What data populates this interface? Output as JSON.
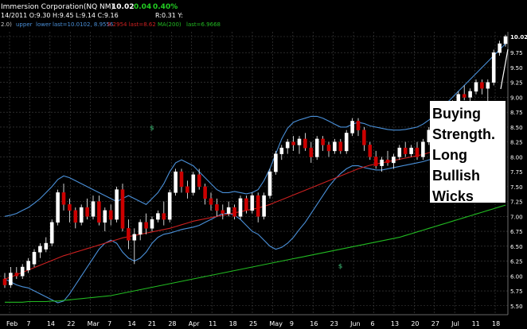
{
  "header": {
    "line1": {
      "symbol": "Immersion Corporation(NQ NM)",
      "last": "10.02",
      "change": "0.04",
      "change_pct": "0.40%",
      "date_ohlc": "14/2011 O:9.30 H:9.45 L:9.14 C:9.16",
      "right_stats": "R:0.31   Y:"
    },
    "line2": {
      "prefix": "2.0)",
      "upper": "upper",
      "lower": "lower",
      "last_label": "last=10.0102, 8.9556",
      "red_part": "8.2954  last=8.62",
      "ma_label": "MA(200)",
      "ma_last": "last=6.9668"
    }
  },
  "colors": {
    "up_candle": "#ffffff",
    "down_candle": "#cc0000",
    "bollinger": "#4a90d9",
    "ma_red": "#cc2020",
    "ma200": "#22bb22",
    "grid": "#444444",
    "change_green": "#22cc22",
    "marker": "#2e8b57"
  },
  "chart_data": {
    "type": "candlestick",
    "title": "",
    "y_ticks": [
      "10.02",
      "9.75",
      "9.50",
      "9.25",
      "9.00",
      "8.75",
      "8.50",
      "8.25",
      "8.00",
      "7.75",
      "7.50",
      "7.25",
      "7.00",
      "6.75",
      "6.50",
      "6.25",
      "6.00",
      "5.75",
      "5.50"
    ],
    "ylim": [
      5.35,
      10.1
    ],
    "x_ticks": [
      "Feb",
      "7",
      "14",
      "22",
      "Mar",
      "7",
      "14",
      "21",
      "28",
      "Apr",
      "11",
      "18",
      "25",
      "May",
      "9",
      "16",
      "23",
      "Jun",
      "6",
      "13",
      "20",
      "27",
      "Jul",
      "11",
      "18"
    ],
    "ohlc": [
      [
        5.95,
        6.05,
        5.8,
        5.85
      ],
      [
        5.85,
        6.15,
        5.8,
        6.05
      ],
      [
        6.05,
        6.15,
        5.95,
        6.0
      ],
      [
        6.0,
        6.2,
        5.95,
        6.15
      ],
      [
        6.1,
        6.3,
        6.05,
        6.25
      ],
      [
        6.2,
        6.45,
        6.15,
        6.4
      ],
      [
        6.4,
        6.55,
        6.3,
        6.5
      ],
      [
        6.45,
        6.65,
        6.4,
        6.55
      ],
      [
        6.55,
        6.95,
        6.5,
        6.9
      ],
      [
        6.9,
        7.45,
        6.85,
        7.4
      ],
      [
        7.4,
        7.55,
        7.1,
        7.2
      ],
      [
        7.2,
        7.3,
        6.9,
        7.1
      ],
      [
        7.1,
        7.15,
        6.8,
        6.9
      ],
      [
        6.9,
        7.2,
        6.85,
        7.15
      ],
      [
        7.15,
        7.3,
        6.95,
        7.0
      ],
      [
        7.0,
        7.35,
        6.95,
        7.25
      ],
      [
        7.25,
        7.35,
        6.85,
        6.9
      ],
      [
        6.9,
        7.15,
        6.75,
        7.1
      ],
      [
        7.1,
        7.2,
        6.85,
        6.95
      ],
      [
        6.95,
        7.5,
        6.9,
        7.45
      ],
      [
        7.45,
        7.55,
        6.75,
        6.8
      ],
      [
        6.8,
        6.95,
        6.45,
        6.6
      ],
      [
        6.6,
        6.8,
        6.2,
        6.7
      ],
      [
        6.7,
        6.95,
        6.6,
        6.9
      ],
      [
        6.9,
        7.05,
        6.7,
        6.8
      ],
      [
        6.8,
        7.0,
        6.75,
        6.95
      ],
      [
        6.95,
        7.1,
        6.9,
        7.05
      ],
      [
        7.05,
        7.25,
        6.85,
        6.95
      ],
      [
        6.95,
        7.45,
        6.9,
        7.4
      ],
      [
        7.4,
        7.8,
        7.35,
        7.75
      ],
      [
        7.75,
        7.8,
        7.4,
        7.5
      ],
      [
        7.5,
        7.6,
        7.3,
        7.4
      ],
      [
        7.4,
        7.75,
        7.35,
        7.7
      ],
      [
        7.7,
        7.8,
        7.45,
        7.5
      ],
      [
        7.5,
        7.55,
        7.2,
        7.3
      ],
      [
        7.3,
        7.4,
        7.1,
        7.2
      ],
      [
        7.2,
        7.3,
        7.0,
        7.1
      ],
      [
        7.1,
        7.2,
        6.95,
        7.05
      ],
      [
        7.05,
        7.25,
        7.0,
        7.15
      ],
      [
        7.15,
        7.2,
        6.95,
        7.0
      ],
      [
        7.0,
        7.35,
        6.95,
        7.3
      ],
      [
        7.3,
        7.35,
        7.05,
        7.1
      ],
      [
        7.1,
        7.4,
        7.05,
        7.35
      ],
      [
        7.35,
        7.4,
        6.9,
        7.0
      ],
      [
        7.0,
        7.4,
        6.95,
        7.35
      ],
      [
        7.35,
        7.8,
        7.3,
        7.75
      ],
      [
        7.75,
        8.1,
        7.7,
        8.05
      ],
      [
        8.05,
        8.2,
        7.95,
        8.15
      ],
      [
        8.15,
        8.3,
        8.05,
        8.25
      ],
      [
        8.25,
        8.35,
        8.1,
        8.2
      ],
      [
        8.2,
        8.35,
        8.05,
        8.3
      ],
      [
        8.3,
        8.4,
        8.1,
        8.15
      ],
      [
        8.15,
        8.25,
        7.9,
        8.0
      ],
      [
        8.0,
        8.35,
        7.95,
        8.3
      ],
      [
        8.3,
        8.35,
        8.1,
        8.2
      ],
      [
        8.2,
        8.25,
        8.0,
        8.1
      ],
      [
        8.1,
        8.3,
        8.05,
        8.25
      ],
      [
        8.25,
        8.3,
        8.05,
        8.1
      ],
      [
        8.1,
        8.45,
        8.05,
        8.4
      ],
      [
        8.4,
        8.65,
        8.35,
        8.6
      ],
      [
        8.6,
        8.65,
        8.35,
        8.45
      ],
      [
        8.45,
        8.5,
        8.1,
        8.2
      ],
      [
        8.2,
        8.25,
        7.95,
        8.0
      ],
      [
        8.0,
        8.1,
        7.8,
        7.85
      ],
      [
        7.85,
        8.0,
        7.75,
        7.95
      ],
      [
        7.95,
        8.1,
        7.85,
        7.9
      ],
      [
        7.9,
        8.05,
        7.8,
        8.0
      ],
      [
        8.0,
        8.2,
        7.95,
        8.15
      ],
      [
        8.15,
        8.25,
        8.0,
        8.05
      ],
      [
        8.05,
        8.2,
        8.0,
        8.15
      ],
      [
        8.15,
        8.25,
        7.95,
        8.0
      ],
      [
        8.0,
        8.3,
        7.95,
        8.25
      ],
      [
        8.25,
        8.5,
        8.2,
        8.45
      ],
      [
        8.45,
        8.6,
        8.4,
        8.55
      ],
      [
        8.55,
        8.7,
        8.5,
        8.65
      ],
      [
        8.65,
        8.8,
        8.6,
        8.75
      ],
      [
        8.75,
        8.95,
        8.7,
        8.9
      ],
      [
        8.9,
        9.1,
        8.85,
        9.05
      ],
      [
        9.05,
        9.2,
        8.95,
        9.0
      ],
      [
        9.0,
        9.15,
        8.9,
        9.1
      ],
      [
        9.1,
        9.3,
        9.05,
        9.25
      ],
      [
        9.25,
        9.3,
        9.05,
        9.15
      ],
      [
        9.15,
        9.3,
        8.5,
        9.25
      ],
      [
        9.25,
        9.8,
        9.2,
        9.75
      ],
      [
        9.75,
        9.95,
        9.7,
        9.9
      ],
      [
        9.9,
        10.05,
        9.85,
        10.02
      ]
    ],
    "series": [
      {
        "type": "upper-band",
        "values": [
          7.0,
          7.02,
          7.05,
          7.1,
          7.15,
          7.22,
          7.3,
          7.4,
          7.5,
          7.62,
          7.68,
          7.65,
          7.6,
          7.55,
          7.5,
          7.45,
          7.4,
          7.35,
          7.3,
          7.25,
          7.3,
          7.35,
          7.3,
          7.25,
          7.2,
          7.3,
          7.4,
          7.55,
          7.75,
          7.9,
          7.95,
          7.9,
          7.85,
          7.75,
          7.65,
          7.55,
          7.45,
          7.4,
          7.4,
          7.42,
          7.4,
          7.38,
          7.4,
          7.45,
          7.6,
          7.8,
          8.05,
          8.3,
          8.48,
          8.58,
          8.62,
          8.65,
          8.68,
          8.68,
          8.65,
          8.6,
          8.55,
          8.5,
          8.5,
          8.55,
          8.58,
          8.56,
          8.52,
          8.5,
          8.48,
          8.46,
          8.45,
          8.45,
          8.46,
          8.48,
          8.5,
          8.55,
          8.62,
          8.7,
          8.8,
          8.9,
          9.0,
          9.1,
          9.2,
          9.3,
          9.4,
          9.5,
          9.6,
          9.7,
          9.8,
          9.9
        ]
      },
      {
        "type": "lower-band",
        "values": [
          5.95,
          5.9,
          5.85,
          5.82,
          5.8,
          5.75,
          5.7,
          5.65,
          5.6,
          5.55,
          5.58,
          5.7,
          5.85,
          6.0,
          6.15,
          6.3,
          6.45,
          6.55,
          6.6,
          6.55,
          6.4,
          6.3,
          6.25,
          6.3,
          6.4,
          6.55,
          6.65,
          6.7,
          6.72,
          6.75,
          6.78,
          6.8,
          6.82,
          6.85,
          6.9,
          6.95,
          7.0,
          7.05,
          7.05,
          7.02,
          6.95,
          6.85,
          6.75,
          6.7,
          6.6,
          6.5,
          6.45,
          6.48,
          6.55,
          6.65,
          6.78,
          6.9,
          7.05,
          7.2,
          7.35,
          7.5,
          7.62,
          7.72,
          7.8,
          7.85,
          7.85,
          7.82,
          7.8,
          7.78,
          7.78,
          7.8,
          7.82,
          7.84,
          7.86,
          7.88,
          7.9,
          7.92,
          7.95,
          7.97,
          8.0,
          8.03,
          8.06,
          8.1,
          8.14,
          8.18,
          8.22,
          8.26,
          8.3,
          8.34,
          8.38,
          8.42
        ]
      },
      {
        "type": "ma-red",
        "values": [
          5.95,
          5.98,
          6.02,
          6.06,
          6.1,
          6.14,
          6.18,
          6.22,
          6.26,
          6.3,
          6.34,
          6.37,
          6.4,
          6.43,
          6.46,
          6.49,
          6.52,
          6.55,
          6.58,
          6.61,
          6.64,
          6.66,
          6.68,
          6.7,
          6.72,
          6.74,
          6.76,
          6.78,
          6.8,
          6.83,
          6.86,
          6.89,
          6.92,
          6.94,
          6.96,
          6.98,
          7.0,
          7.02,
          7.04,
          7.06,
          7.08,
          7.1,
          7.12,
          7.14,
          7.17,
          7.2,
          7.24,
          7.28,
          7.32,
          7.36,
          7.4,
          7.44,
          7.48,
          7.52,
          7.56,
          7.6,
          7.64,
          7.68,
          7.72,
          7.76,
          7.8,
          7.83,
          7.86,
          7.88,
          7.9,
          7.92,
          7.94,
          7.96,
          7.98,
          8.0,
          8.02,
          8.04,
          8.07,
          8.1,
          8.13,
          8.16,
          8.19,
          8.22,
          8.26,
          8.3,
          8.34,
          8.38,
          8.42,
          8.46,
          8.5,
          8.55
        ]
      },
      {
        "type": "ma200",
        "values": [
          5.56,
          5.56,
          5.56,
          5.56,
          5.57,
          5.57,
          5.57,
          5.57,
          5.58,
          5.58,
          5.59,
          5.6,
          5.61,
          5.62,
          5.63,
          5.64,
          5.65,
          5.66,
          5.67,
          5.69,
          5.71,
          5.73,
          5.75,
          5.77,
          5.79,
          5.81,
          5.83,
          5.85,
          5.87,
          5.89,
          5.91,
          5.93,
          5.95,
          5.97,
          5.99,
          6.01,
          6.03,
          6.05,
          6.07,
          6.09,
          6.11,
          6.13,
          6.15,
          6.17,
          6.19,
          6.21,
          6.23,
          6.25,
          6.27,
          6.29,
          6.31,
          6.33,
          6.35,
          6.37,
          6.39,
          6.41,
          6.43,
          6.45,
          6.47,
          6.49,
          6.51,
          6.53,
          6.55,
          6.57,
          6.59,
          6.61,
          6.63,
          6.65,
          6.68,
          6.71,
          6.74,
          6.77,
          6.8,
          6.83,
          6.86,
          6.89,
          6.92,
          6.95,
          6.98,
          7.01,
          7.04,
          7.07,
          7.1,
          7.13,
          7.16,
          7.19
        ]
      }
    ],
    "markers": [
      {
        "index": 25,
        "label": "$",
        "y": 8.45
      },
      {
        "index": 57,
        "label": "$",
        "y": 6.13
      }
    ],
    "annotation": {
      "lines": [
        "Buying",
        "Strength.",
        "Long",
        "Bullish",
        "Wicks"
      ]
    },
    "grid": true
  }
}
